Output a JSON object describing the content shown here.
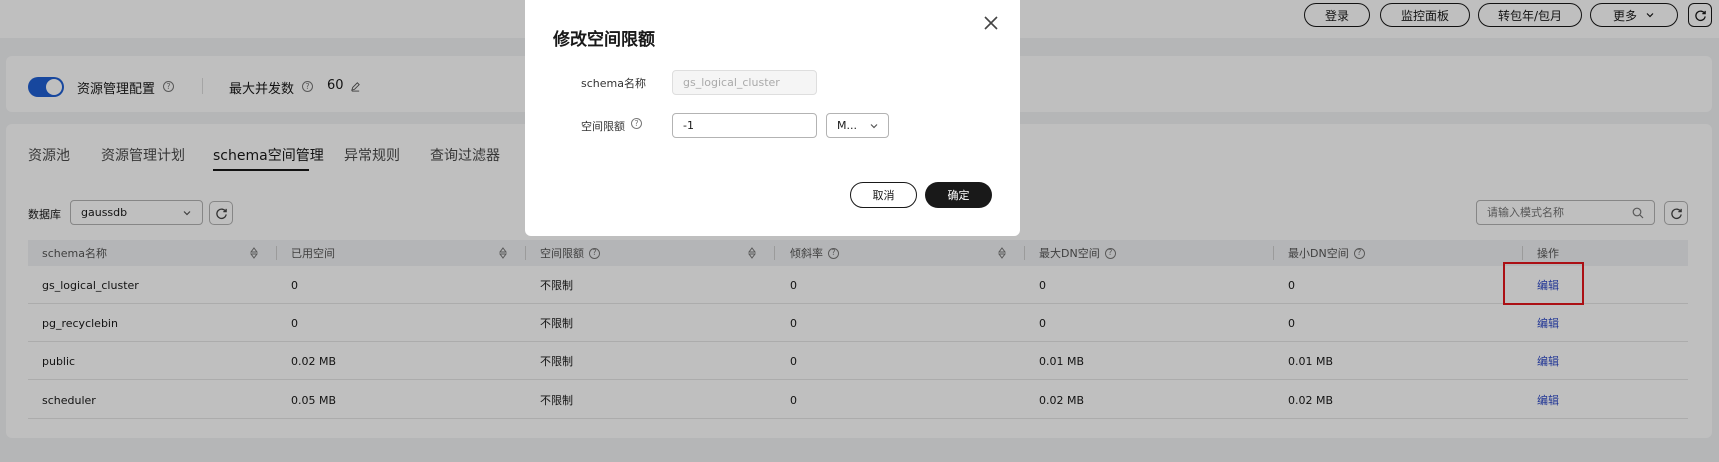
{
  "header": {
    "buttons": [
      "登录",
      "监控面板",
      "转包年/包月",
      "更多"
    ]
  },
  "config": {
    "toggle_label": "资源管理配置",
    "toggle_on": true,
    "max_concurrency_label": "最大并发数",
    "max_concurrency_value": "60"
  },
  "tabs": [
    "资源池",
    "资源管理计划",
    "schema空间管理",
    "异常规则",
    "查询过滤器"
  ],
  "active_tab": "schema空间管理",
  "filter": {
    "db_label": "数据库",
    "db_value": "gaussdb",
    "search_placeholder": "请输入模式名称"
  },
  "table": {
    "columns": [
      "schema名称",
      "已用空间",
      "空间限额",
      "倾斜率",
      "最大DN空间",
      "最小DN空间",
      "操作"
    ],
    "rows": [
      [
        "gs_logical_cluster",
        "0",
        "不限制",
        "0",
        "0",
        "0",
        "编辑"
      ],
      [
        "pg_recyclebin",
        "0",
        "不限制",
        "0",
        "0",
        "0",
        "编辑"
      ],
      [
        "public",
        "0.02 MB",
        "不限制",
        "0",
        "0.01 MB",
        "0.01 MB",
        "编辑"
      ],
      [
        "scheduler",
        "0.05 MB",
        "不限制",
        "0",
        "0.02 MB",
        "0.02 MB",
        "编辑"
      ]
    ]
  },
  "modal": {
    "title": "修改空间限额",
    "schema_label": "schema名称",
    "schema_value": "gs_logical_cluster",
    "quota_label": "空间限额",
    "quota_value": "-1",
    "unit_value": "M...",
    "cancel_label": "取消",
    "confirm_label": "确定"
  },
  "colors": {
    "accent": "#1f5fd3",
    "link": "#2c48c7",
    "highlight": "#e4151b",
    "primary_button": "#191919"
  }
}
